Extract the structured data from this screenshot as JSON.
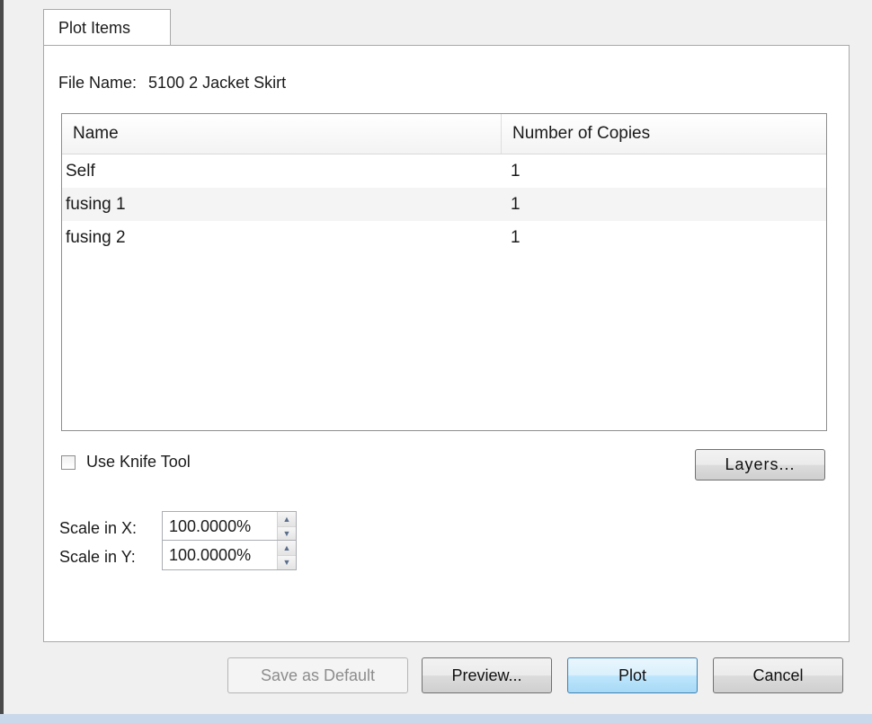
{
  "tab": {
    "label": "Plot Items"
  },
  "file": {
    "label": "File Name:",
    "value": "5100 2 Jacket Skirt"
  },
  "table": {
    "columns": [
      "Name",
      "Number of Copies"
    ],
    "rows": [
      {
        "name": "Self",
        "copies": "1"
      },
      {
        "name": "fusing 1",
        "copies": "1"
      },
      {
        "name": "fusing 2",
        "copies": "1"
      }
    ]
  },
  "options": {
    "knife_tool_label": "Use Knife Tool",
    "knife_tool_checked": false,
    "layers_button": "Layers..."
  },
  "scale": {
    "x_label": "Scale in X:",
    "x_value": "100.0000%",
    "y_label": "Scale in Y:",
    "y_value": "100.0000%"
  },
  "footer": {
    "save_default": "Save as Default",
    "preview": "Preview...",
    "plot": "Plot",
    "cancel": "Cancel"
  },
  "icons": {
    "spin_up": "up-arrow-icon",
    "spin_down": "down-arrow-icon"
  }
}
